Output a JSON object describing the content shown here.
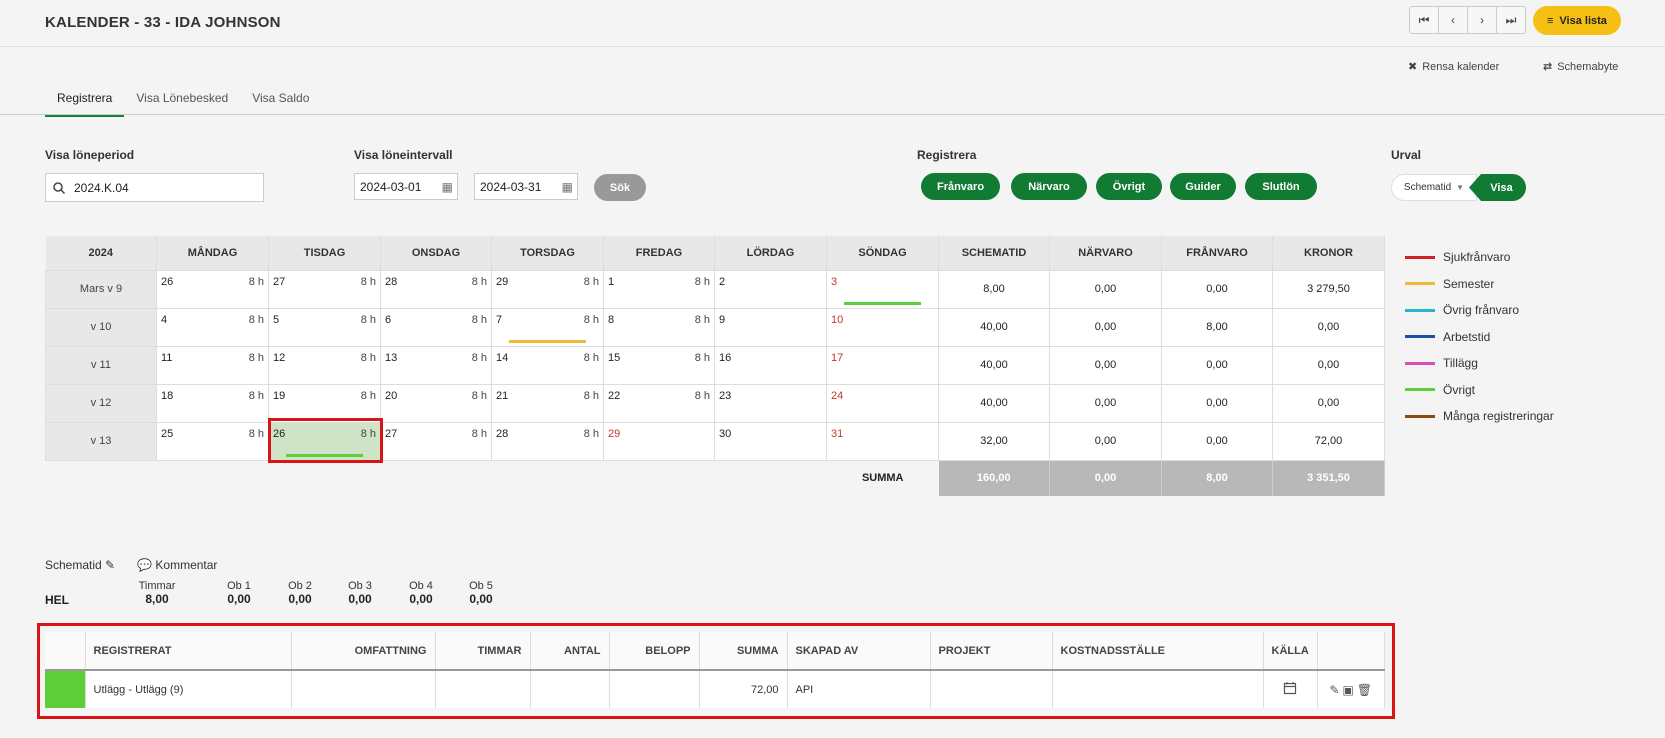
{
  "header": {
    "title": "KALENDER - 33 - IDA JOHNSON",
    "visa_lista": "Visa lista"
  },
  "top_actions": {
    "rensa": "Rensa kalender",
    "schemabyte": "Schemabyte"
  },
  "tabs": [
    "Registrera",
    "Visa Lönebesked",
    "Visa Saldo"
  ],
  "filters": {
    "loneperiod_label": "Visa löneperiod",
    "loneperiod_value": "2024.K.04",
    "intervall_label": "Visa löneintervall",
    "date_from": "2024-03-01",
    "date_to": "2024-03-31",
    "sok": "Sök",
    "registrera_label": "Registrera",
    "registrera_buttons": [
      "Frånvaro",
      "Närvaro",
      "Övrigt",
      "Guider",
      "Slutlön"
    ],
    "urval_label": "Urval",
    "urval_select": "Schematid",
    "urval_visa": "Visa"
  },
  "calendar": {
    "year": "2024",
    "days": [
      "MÅNDAG",
      "TISDAG",
      "ONSDAG",
      "TORSDAG",
      "FREDAG",
      "LÖRDAG",
      "SÖNDAG"
    ],
    "sum_headers": [
      "SCHEMATID",
      "NÄRVARO",
      "FRÅNVARO",
      "KRONOR"
    ],
    "weeks": [
      {
        "label": "Mars v 9",
        "days": [
          [
            "26",
            "8 h"
          ],
          [
            "27",
            "8 h"
          ],
          [
            "28",
            "8 h"
          ],
          [
            "29",
            "8 h"
          ],
          [
            "1",
            "8 h"
          ],
          [
            "2",
            ""
          ],
          [
            "3",
            ""
          ]
        ],
        "sums": [
          "8,00",
          "0,00",
          "0,00",
          "3 279,50"
        ]
      },
      {
        "label": "v 10",
        "days": [
          [
            "4",
            "8 h"
          ],
          [
            "5",
            "8 h"
          ],
          [
            "6",
            "8 h"
          ],
          [
            "7",
            "8 h"
          ],
          [
            "8",
            "8 h"
          ],
          [
            "9",
            ""
          ],
          [
            "10",
            ""
          ]
        ],
        "sums": [
          "40,00",
          "0,00",
          "8,00",
          "0,00"
        ]
      },
      {
        "label": "v 11",
        "days": [
          [
            "11",
            "8 h"
          ],
          [
            "12",
            "8 h"
          ],
          [
            "13",
            "8 h"
          ],
          [
            "14",
            "8 h"
          ],
          [
            "15",
            "8 h"
          ],
          [
            "16",
            ""
          ],
          [
            "17",
            ""
          ]
        ],
        "sums": [
          "40,00",
          "0,00",
          "0,00",
          "0,00"
        ]
      },
      {
        "label": "v 12",
        "days": [
          [
            "18",
            "8 h"
          ],
          [
            "19",
            "8 h"
          ],
          [
            "20",
            "8 h"
          ],
          [
            "21",
            "8 h"
          ],
          [
            "22",
            "8 h"
          ],
          [
            "23",
            ""
          ],
          [
            "24",
            ""
          ]
        ],
        "sums": [
          "40,00",
          "0,00",
          "0,00",
          "0,00"
        ]
      },
      {
        "label": "v 13",
        "days": [
          [
            "25",
            "8 h"
          ],
          [
            "26",
            "8 h"
          ],
          [
            "27",
            "8 h"
          ],
          [
            "28",
            "8 h"
          ],
          [
            "29",
            ""
          ],
          [
            "30",
            ""
          ],
          [
            "31",
            ""
          ]
        ],
        "sums": [
          "32,00",
          "0,00",
          "0,00",
          "72,00"
        ]
      }
    ],
    "summa_label": "SUMMA",
    "totals": [
      "160,00",
      "0,00",
      "8,00",
      "3 351,50"
    ]
  },
  "legend": [
    {
      "label": "Sjukfrånvaro",
      "color": "#d42020"
    },
    {
      "label": "Semester",
      "color": "#f0b93a"
    },
    {
      "label": "Övrig frånvaro",
      "color": "#28b5cf"
    },
    {
      "label": "Arbetstid",
      "color": "#1a4fa8"
    },
    {
      "label": "Tillägg",
      "color": "#d94fb3"
    },
    {
      "label": "Övrigt",
      "color": "#5ccf3a"
    },
    {
      "label": "Många registreringar",
      "color": "#8a4a10"
    }
  ],
  "lower": {
    "schematid": "Schematid",
    "kommentar": "Kommentar",
    "hel": "HEL",
    "cols": [
      {
        "h": "Timmar",
        "v": "8,00"
      },
      {
        "h": "Ob 1",
        "v": "0,00"
      },
      {
        "h": "Ob 2",
        "v": "0,00"
      },
      {
        "h": "Ob 3",
        "v": "0,00"
      },
      {
        "h": "Ob 4",
        "v": "0,00"
      },
      {
        "h": "Ob 5",
        "v": "0,00"
      }
    ]
  },
  "detail": {
    "headers": [
      "REGISTRERAT",
      "OMFATTNING",
      "TIMMAR",
      "ANTAL",
      "BELOPP",
      "SUMMA",
      "SKAPAD AV",
      "PROJEKT",
      "KOSTNADSSTÄLLE",
      "KÄLLA"
    ],
    "row": {
      "registrerat": "Utlägg - Utlägg (9)",
      "omfattning": "",
      "timmar": "",
      "antal": "",
      "belopp": "",
      "summa": "72,00",
      "skapad_av": "API",
      "projekt": "",
      "kostnadsstalle": ""
    }
  }
}
